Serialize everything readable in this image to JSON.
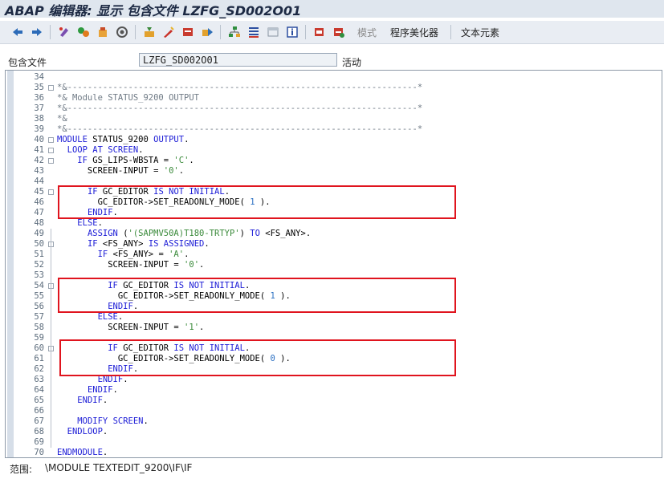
{
  "window": {
    "title": "ABAP 编辑器: 显示 包含文件 LZFG_SD002O01"
  },
  "toolbar": {
    "icons": [
      "back-arrow-icon",
      "forward-arrow-icon",
      "other-object-icon",
      "display-change-icon",
      "activate-icon",
      "check-icon",
      "where-used-icon",
      "position-icon",
      "debug-icon",
      "execute-icon",
      "hierarchy-icon",
      "align-icon",
      "display-object-icon",
      "info-icon",
      "pattern-icon",
      "pretty-print-icon"
    ],
    "mode_label": "模式",
    "pretty_printer_label": "程序美化器",
    "text_elements_label": "文本元素"
  },
  "field": {
    "label": "包含文件",
    "value": "LZFG_SD002O01",
    "status": "活动"
  },
  "editor": {
    "lines": [
      {
        "num": "34",
        "text": ""
      },
      {
        "num": "35",
        "text": "*&---------------------------------------------------------------------*"
      },
      {
        "num": "36",
        "text": "*& Module STATUS_9200 OUTPUT"
      },
      {
        "num": "37",
        "text": "*&---------------------------------------------------------------------*"
      },
      {
        "num": "38",
        "text": "*&"
      },
      {
        "num": "39",
        "text": "*&---------------------------------------------------------------------*"
      },
      {
        "num": "40",
        "text": "MODULE STATUS_9200 OUTPUT."
      },
      {
        "num": "41",
        "text": "  LOOP AT SCREEN."
      },
      {
        "num": "42",
        "text": "    IF GS_LIPS-WBSTA = 'C'."
      },
      {
        "num": "43",
        "text": "      SCREEN-INPUT = '0'."
      },
      {
        "num": "44",
        "text": ""
      },
      {
        "num": "45",
        "text": "      IF GC_EDITOR IS NOT INITIAL."
      },
      {
        "num": "46",
        "text": "        GC_EDITOR->SET_READONLY_MODE( 1 )."
      },
      {
        "num": "47",
        "text": "      ENDIF."
      },
      {
        "num": "48",
        "text": "    ELSE."
      },
      {
        "num": "49",
        "text": "      ASSIGN ('(SAPMV50A)T180-TRTYP') TO <FS_ANY>."
      },
      {
        "num": "50",
        "text": "      IF <FS_ANY> IS ASSIGNED."
      },
      {
        "num": "51",
        "text": "        IF <FS_ANY> = 'A'."
      },
      {
        "num": "52",
        "text": "          SCREEN-INPUT = '0'."
      },
      {
        "num": "53",
        "text": ""
      },
      {
        "num": "54",
        "text": "          IF GC_EDITOR IS NOT INITIAL."
      },
      {
        "num": "55",
        "text": "            GC_EDITOR->SET_READONLY_MODE( 1 )."
      },
      {
        "num": "56",
        "text": "          ENDIF."
      },
      {
        "num": "57",
        "text": "        ELSE."
      },
      {
        "num": "58",
        "text": "          SCREEN-INPUT = '1'."
      },
      {
        "num": "59",
        "text": ""
      },
      {
        "num": "60",
        "text": "          IF GC_EDITOR IS NOT INITIAL."
      },
      {
        "num": "61",
        "text": "            GC_EDITOR->SET_READONLY_MODE( 0 )."
      },
      {
        "num": "62",
        "text": "          ENDIF."
      },
      {
        "num": "63",
        "text": "        ENDIF."
      },
      {
        "num": "64",
        "text": "      ENDIF."
      },
      {
        "num": "65",
        "text": "    ENDIF."
      },
      {
        "num": "66",
        "text": ""
      },
      {
        "num": "67",
        "text": "    MODIFY SCREEN."
      },
      {
        "num": "68",
        "text": "  ENDLOOP."
      },
      {
        "num": "69",
        "text": ""
      },
      {
        "num": "70",
        "text": "ENDMODULE."
      }
    ]
  },
  "status": {
    "scope_label": "范围:",
    "scope_value": "\\MODULE TEXTEDIT_9200\\IF\\IF"
  },
  "colors": {
    "keyword": "#1b1bd6",
    "string": "#3a8a3a",
    "number": "#2a6fc2",
    "comment": "#6f7a85",
    "highlight": "#e0141e"
  }
}
